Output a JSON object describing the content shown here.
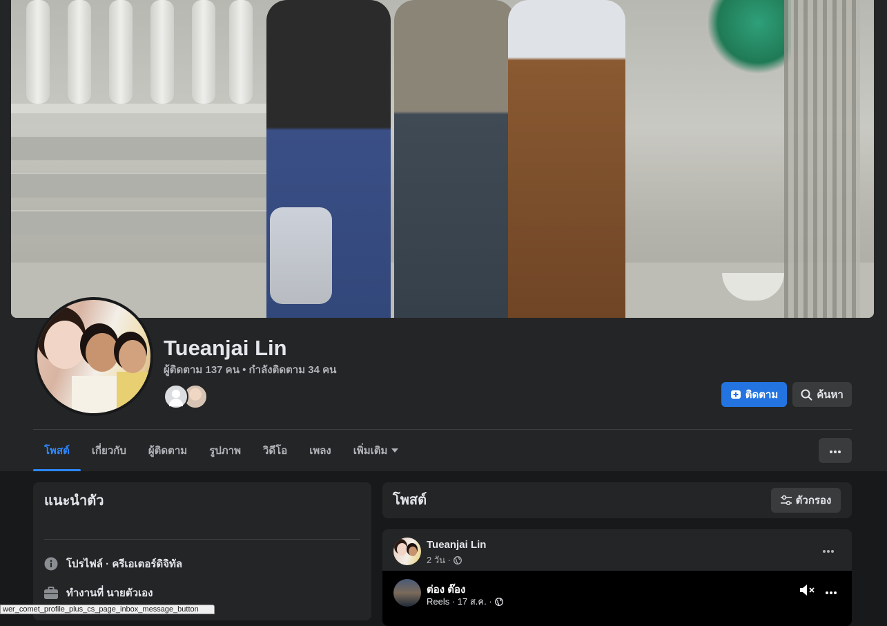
{
  "profile": {
    "name": "Tueanjai Lin",
    "follow_stats": "ผู้ติดตาม 137 คน • กำลังติดตาม 34 คน"
  },
  "actions": {
    "follow_label": "ติดตาม",
    "search_label": "ค้นหา"
  },
  "tabs": [
    {
      "label": "โพสต์",
      "active": true
    },
    {
      "label": "เกี่ยวกับ"
    },
    {
      "label": "ผู้ติดตาม"
    },
    {
      "label": "รูปภาพ"
    },
    {
      "label": "วิดีโอ"
    },
    {
      "label": "เพลง"
    },
    {
      "label": "เพิ่มเติม"
    }
  ],
  "intro": {
    "title": "แนะนำตัว",
    "profile_row": "โปรไฟล์ · ครีเอเตอร์ดิจิทัล",
    "work_row": "ทำงานที่ นายตัวเอง"
  },
  "posts": {
    "title": "โพสต์",
    "filter_label": "ตัวกรอง"
  },
  "post": {
    "author": "Tueanjai Lin",
    "time": "2 วัน ·",
    "reel": {
      "author": "ต่อง ต๊อง",
      "meta": "Reels · 17 ส.ค. ·"
    }
  },
  "tooltip": {
    "text": "wer_comet_profile_plus_cs_page_inbox_message_button"
  },
  "colors": {
    "accent": "#2374e1",
    "tab_active": "#2d88ff",
    "background": "#18191a",
    "surface": "#242526"
  }
}
